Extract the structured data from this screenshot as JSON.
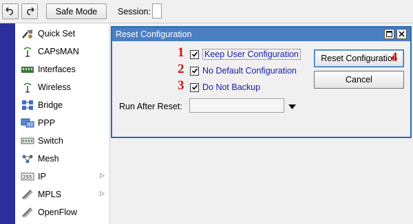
{
  "toolbar": {
    "undo_icon": "undo-icon",
    "redo_icon": "redo-icon",
    "safe_mode_label": "Safe Mode",
    "session_label": "Session:"
  },
  "sidebar": {
    "accent_color": "#2b2e9c",
    "items": [
      {
        "label": "Quick Set",
        "icon": "quick-set-icon",
        "submenu": false
      },
      {
        "label": "CAPsMAN",
        "icon": "capsman-icon",
        "submenu": false
      },
      {
        "label": "Interfaces",
        "icon": "interfaces-icon",
        "submenu": false
      },
      {
        "label": "Wireless",
        "icon": "wireless-icon",
        "submenu": false
      },
      {
        "label": "Bridge",
        "icon": "bridge-icon",
        "submenu": false
      },
      {
        "label": "PPP",
        "icon": "ppp-icon",
        "submenu": false
      },
      {
        "label": "Switch",
        "icon": "switch-icon",
        "submenu": false
      },
      {
        "label": "Mesh",
        "icon": "mesh-icon",
        "submenu": false
      },
      {
        "label": "IP",
        "icon": "ip-icon",
        "submenu": true
      },
      {
        "label": "MPLS",
        "icon": "mpls-icon",
        "submenu": true
      },
      {
        "label": "OpenFlow",
        "icon": "openflow-icon",
        "submenu": false
      }
    ]
  },
  "dialog": {
    "title": "Reset Configuration",
    "title_color": "#4a7fc2",
    "annotation_color": "#cc1111",
    "options": [
      {
        "number": "1",
        "label": "Keep User Configuration",
        "checked": true
      },
      {
        "number": "2",
        "label": "No Default Configuration",
        "checked": true
      },
      {
        "number": "3",
        "label": "Do Not Backup",
        "checked": true
      }
    ],
    "reset_button_label": "Reset Configuration",
    "reset_button_number": "4",
    "cancel_button_label": "Cancel",
    "run_after_reset_label": "Run After Reset:",
    "run_after_reset_value": ""
  }
}
